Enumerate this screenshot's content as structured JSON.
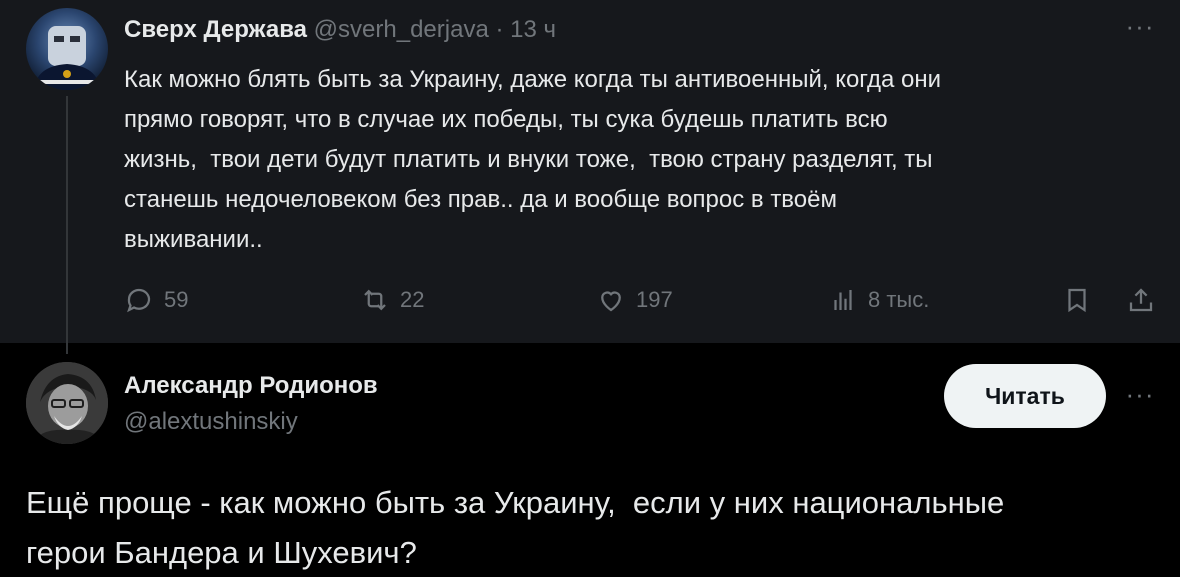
{
  "parent": {
    "display_name": "Сверх Держава",
    "handle": "@sverh_derjava",
    "dot": "·",
    "time": "13 ч",
    "text": "Как можно блять быть за Украину, даже когда ты антивоенный, когда они\nпрямо говорят, что в случае их победы, ты сука будешь платить всю\nжизнь,  твои дети будут платить и внуки тоже,  твою страну разделят, ты\nстанешь недочеловеком без прав.. да и вообще вопрос в твоём\nвыживании..",
    "more_icon": "···",
    "actions": {
      "replies": "59",
      "reposts": "22",
      "likes": "197",
      "views": "8 тыс."
    }
  },
  "reply": {
    "display_name": "Александр Родионов",
    "handle": "@alextushinskiy",
    "follow_label": "Читать",
    "more_icon": "···",
    "text": "Ещё проще - как можно быть за Украину,  если у них национальные\nгерои Бандера и Шухевич?"
  },
  "colors": {
    "background": "#000000",
    "parent_background": "#16181c",
    "primary_text": "#e7e9ea",
    "secondary_text": "#71767b",
    "follow_button_bg": "#eff3f4"
  },
  "icons": {
    "reply": "reply-icon",
    "repost": "repost-icon",
    "like": "heart-icon",
    "views": "views-icon",
    "bookmark": "bookmark-icon",
    "share": "share-icon"
  }
}
